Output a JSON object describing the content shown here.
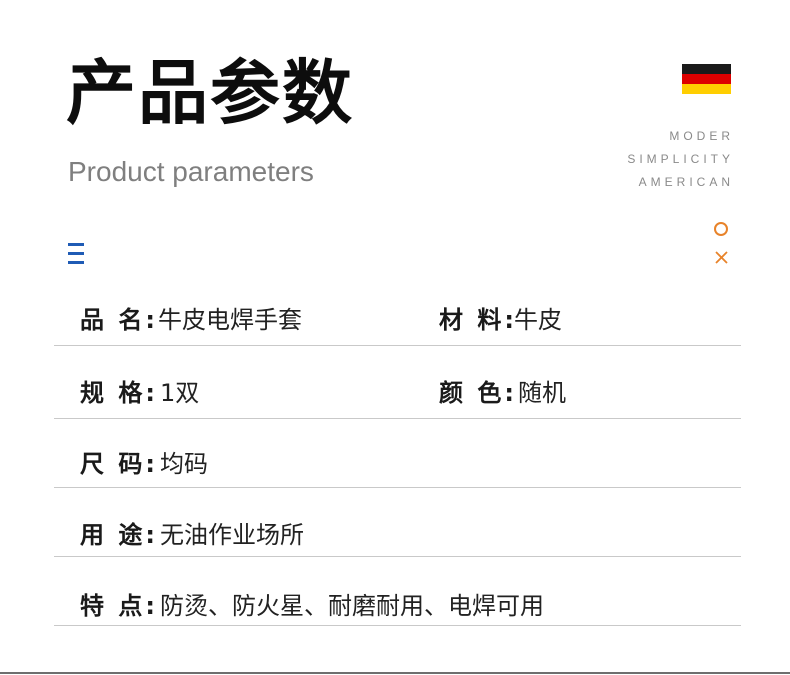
{
  "header": {
    "title_cn": "产品参数",
    "title_en": "Product parameters"
  },
  "tagline": [
    "MODER",
    "SIMPLICITY",
    "AMERICAN"
  ],
  "flag_colors": [
    "#1a1a1a",
    "#dd0000",
    "#ffce00"
  ],
  "icons": {
    "menu": "menu-icon",
    "circle": "circle-icon",
    "close": "close-icon",
    "accent_blue": "#1f5bb5",
    "accent_orange": "#e8832a"
  },
  "params": [
    {
      "left": {
        "label": "品 名:",
        "value": "牛皮电焊手套"
      },
      "right": {
        "label": "材 料:",
        "value": "牛皮"
      }
    },
    {
      "left": {
        "label": "规 格:",
        "value": "1双"
      },
      "right": {
        "label": "颜 色:",
        "value": "随机"
      }
    },
    {
      "left": {
        "label": "尺 码:",
        "value": "均码"
      }
    },
    {
      "left": {
        "label": "用 途:",
        "value": "无油作业场所"
      }
    },
    {
      "left": {
        "label": "特 点:",
        "value": "防烫、防火星、耐磨耐用、电焊可用"
      }
    }
  ]
}
